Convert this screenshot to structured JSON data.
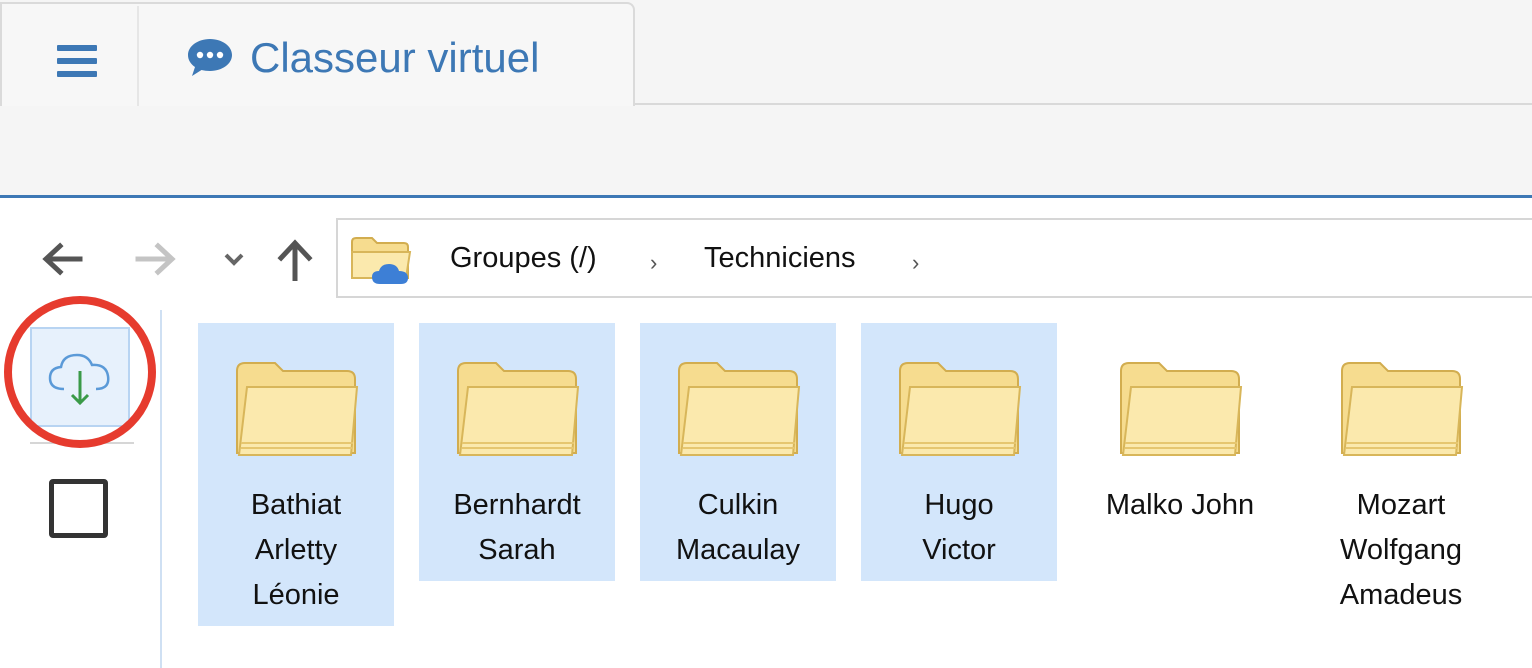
{
  "window": {
    "tab_title": "Classeur virtuel",
    "tab_icon": "chat-bubble-icon",
    "accent_color": "#3d78b5"
  },
  "breadcrumb": {
    "items": [
      {
        "label": "Groupes (/)"
      },
      {
        "label": "Techniciens"
      }
    ]
  },
  "toolbar": {
    "download_icon": "cloud-download-icon",
    "select_all_icon": "checkbox-icon"
  },
  "folders": [
    {
      "name": "Bathiat Arletty Léonie",
      "lines": [
        "Bathiat",
        "Arletty",
        "Léonie"
      ],
      "selected": true
    },
    {
      "name": "Bernhardt Sarah",
      "lines": [
        "Bernhardt",
        "Sarah"
      ],
      "selected": true
    },
    {
      "name": "Culkin Macaulay",
      "lines": [
        "Culkin",
        "Macaulay"
      ],
      "selected": true
    },
    {
      "name": "Hugo Victor",
      "lines": [
        "Hugo",
        "Victor"
      ],
      "selected": true
    },
    {
      "name": "Malko John",
      "lines": [
        "Malko John"
      ],
      "selected": false
    },
    {
      "name": "Mozart Wolfgang Amadeus",
      "lines": [
        "Mozart",
        "Wolfgang",
        "Amadeus"
      ],
      "selected": false
    }
  ],
  "colors": {
    "selection_bg": "#d3e6fb",
    "highlight_ring": "#e63b2e",
    "folder_fill": "#fbe6a2",
    "folder_stroke": "#d8b65a"
  }
}
